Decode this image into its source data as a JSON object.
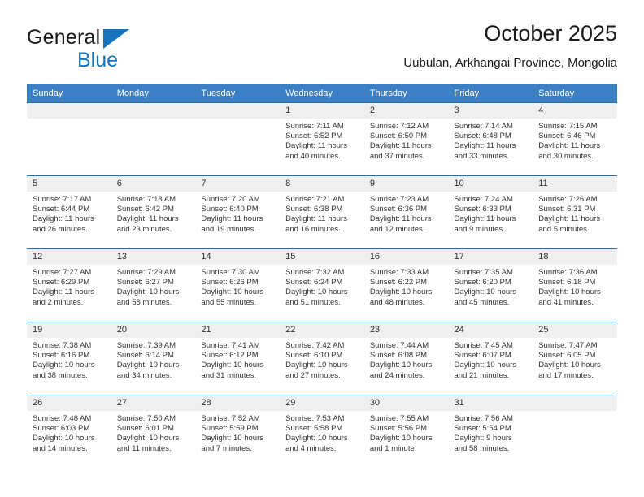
{
  "brand": {
    "name_part1": "General",
    "name_part2": "Blue",
    "accent_color": "#1574bc"
  },
  "header": {
    "title": "October 2025",
    "subtitle": "Uubulan, Arkhangai Province, Mongolia"
  },
  "calendar": {
    "header_bg": "#3b7fc4",
    "daynum_bg": "#efefef",
    "weekday_headers": [
      "Sunday",
      "Monday",
      "Tuesday",
      "Wednesday",
      "Thursday",
      "Friday",
      "Saturday"
    ],
    "weeks": [
      [
        {
          "day": "",
          "lines": []
        },
        {
          "day": "",
          "lines": []
        },
        {
          "day": "",
          "lines": []
        },
        {
          "day": "1",
          "lines": [
            "Sunrise: 7:11 AM",
            "Sunset: 6:52 PM",
            "Daylight: 11 hours",
            "and 40 minutes."
          ]
        },
        {
          "day": "2",
          "lines": [
            "Sunrise: 7:12 AM",
            "Sunset: 6:50 PM",
            "Daylight: 11 hours",
            "and 37 minutes."
          ]
        },
        {
          "day": "3",
          "lines": [
            "Sunrise: 7:14 AM",
            "Sunset: 6:48 PM",
            "Daylight: 11 hours",
            "and 33 minutes."
          ]
        },
        {
          "day": "4",
          "lines": [
            "Sunrise: 7:15 AM",
            "Sunset: 6:46 PM",
            "Daylight: 11 hours",
            "and 30 minutes."
          ]
        }
      ],
      [
        {
          "day": "5",
          "lines": [
            "Sunrise: 7:17 AM",
            "Sunset: 6:44 PM",
            "Daylight: 11 hours",
            "and 26 minutes."
          ]
        },
        {
          "day": "6",
          "lines": [
            "Sunrise: 7:18 AM",
            "Sunset: 6:42 PM",
            "Daylight: 11 hours",
            "and 23 minutes."
          ]
        },
        {
          "day": "7",
          "lines": [
            "Sunrise: 7:20 AM",
            "Sunset: 6:40 PM",
            "Daylight: 11 hours",
            "and 19 minutes."
          ]
        },
        {
          "day": "8",
          "lines": [
            "Sunrise: 7:21 AM",
            "Sunset: 6:38 PM",
            "Daylight: 11 hours",
            "and 16 minutes."
          ]
        },
        {
          "day": "9",
          "lines": [
            "Sunrise: 7:23 AM",
            "Sunset: 6:36 PM",
            "Daylight: 11 hours",
            "and 12 minutes."
          ]
        },
        {
          "day": "10",
          "lines": [
            "Sunrise: 7:24 AM",
            "Sunset: 6:33 PM",
            "Daylight: 11 hours",
            "and 9 minutes."
          ]
        },
        {
          "day": "11",
          "lines": [
            "Sunrise: 7:26 AM",
            "Sunset: 6:31 PM",
            "Daylight: 11 hours",
            "and 5 minutes."
          ]
        }
      ],
      [
        {
          "day": "12",
          "lines": [
            "Sunrise: 7:27 AM",
            "Sunset: 6:29 PM",
            "Daylight: 11 hours",
            "and 2 minutes."
          ]
        },
        {
          "day": "13",
          "lines": [
            "Sunrise: 7:29 AM",
            "Sunset: 6:27 PM",
            "Daylight: 10 hours",
            "and 58 minutes."
          ]
        },
        {
          "day": "14",
          "lines": [
            "Sunrise: 7:30 AM",
            "Sunset: 6:26 PM",
            "Daylight: 10 hours",
            "and 55 minutes."
          ]
        },
        {
          "day": "15",
          "lines": [
            "Sunrise: 7:32 AM",
            "Sunset: 6:24 PM",
            "Daylight: 10 hours",
            "and 51 minutes."
          ]
        },
        {
          "day": "16",
          "lines": [
            "Sunrise: 7:33 AM",
            "Sunset: 6:22 PM",
            "Daylight: 10 hours",
            "and 48 minutes."
          ]
        },
        {
          "day": "17",
          "lines": [
            "Sunrise: 7:35 AM",
            "Sunset: 6:20 PM",
            "Daylight: 10 hours",
            "and 45 minutes."
          ]
        },
        {
          "day": "18",
          "lines": [
            "Sunrise: 7:36 AM",
            "Sunset: 6:18 PM",
            "Daylight: 10 hours",
            "and 41 minutes."
          ]
        }
      ],
      [
        {
          "day": "19",
          "lines": [
            "Sunrise: 7:38 AM",
            "Sunset: 6:16 PM",
            "Daylight: 10 hours",
            "and 38 minutes."
          ]
        },
        {
          "day": "20",
          "lines": [
            "Sunrise: 7:39 AM",
            "Sunset: 6:14 PM",
            "Daylight: 10 hours",
            "and 34 minutes."
          ]
        },
        {
          "day": "21",
          "lines": [
            "Sunrise: 7:41 AM",
            "Sunset: 6:12 PM",
            "Daylight: 10 hours",
            "and 31 minutes."
          ]
        },
        {
          "day": "22",
          "lines": [
            "Sunrise: 7:42 AM",
            "Sunset: 6:10 PM",
            "Daylight: 10 hours",
            "and 27 minutes."
          ]
        },
        {
          "day": "23",
          "lines": [
            "Sunrise: 7:44 AM",
            "Sunset: 6:08 PM",
            "Daylight: 10 hours",
            "and 24 minutes."
          ]
        },
        {
          "day": "24",
          "lines": [
            "Sunrise: 7:45 AM",
            "Sunset: 6:07 PM",
            "Daylight: 10 hours",
            "and 21 minutes."
          ]
        },
        {
          "day": "25",
          "lines": [
            "Sunrise: 7:47 AM",
            "Sunset: 6:05 PM",
            "Daylight: 10 hours",
            "and 17 minutes."
          ]
        }
      ],
      [
        {
          "day": "26",
          "lines": [
            "Sunrise: 7:48 AM",
            "Sunset: 6:03 PM",
            "Daylight: 10 hours",
            "and 14 minutes."
          ]
        },
        {
          "day": "27",
          "lines": [
            "Sunrise: 7:50 AM",
            "Sunset: 6:01 PM",
            "Daylight: 10 hours",
            "and 11 minutes."
          ]
        },
        {
          "day": "28",
          "lines": [
            "Sunrise: 7:52 AM",
            "Sunset: 5:59 PM",
            "Daylight: 10 hours",
            "and 7 minutes."
          ]
        },
        {
          "day": "29",
          "lines": [
            "Sunrise: 7:53 AM",
            "Sunset: 5:58 PM",
            "Daylight: 10 hours",
            "and 4 minutes."
          ]
        },
        {
          "day": "30",
          "lines": [
            "Sunrise: 7:55 AM",
            "Sunset: 5:56 PM",
            "Daylight: 10 hours",
            "and 1 minute."
          ]
        },
        {
          "day": "31",
          "lines": [
            "Sunrise: 7:56 AM",
            "Sunset: 5:54 PM",
            "Daylight: 9 hours",
            "and 58 minutes."
          ]
        },
        {
          "day": "",
          "lines": []
        }
      ]
    ]
  }
}
